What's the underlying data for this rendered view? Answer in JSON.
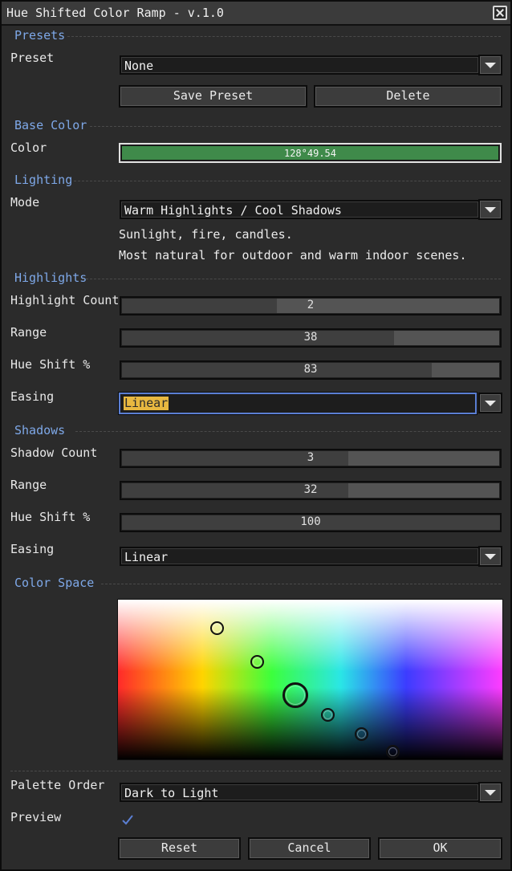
{
  "window": {
    "title": "Hue Shifted Color Ramp - v.1.0"
  },
  "sections": {
    "presets": "Presets",
    "base_color": "Base Color",
    "lighting": "Lighting",
    "highlights": "Highlights",
    "shadows": "Shadows",
    "color_space": "Color Space"
  },
  "presets": {
    "label": "Preset",
    "value": "None",
    "save_label": "Save Preset",
    "delete_label": "Delete"
  },
  "base_color": {
    "label": "Color",
    "value": "128°49.54",
    "swatch": "#3f8a4a"
  },
  "lighting": {
    "label": "Mode",
    "value": "Warm Highlights / Cool Shadows",
    "desc_line1": "Sunlight, fire, candles.",
    "desc_line2": "Most natural for outdoor and warm indoor scenes."
  },
  "highlights": {
    "count_label": "Highlight Count",
    "count_value": "2",
    "count_fill": 0.41,
    "range_label": "Range",
    "range_value": "38",
    "range_fill": 0.72,
    "hue_label": "Hue Shift %",
    "hue_value": "83",
    "hue_fill": 0.82,
    "easing_label": "Easing",
    "easing_value": "Linear"
  },
  "shadows": {
    "count_label": "Shadow Count",
    "count_value": "3",
    "count_fill": 0.6,
    "range_label": "Range",
    "range_value": "32",
    "range_fill": 0.6,
    "hue_label": "Hue Shift %",
    "hue_value": "100",
    "hue_fill": 1.0,
    "easing_label": "Easing",
    "easing_value": "Linear"
  },
  "palette": {
    "order_label": "Palette Order",
    "order_value": "Dark to Light",
    "preview_label": "Preview",
    "preview_checked": true
  },
  "footer": {
    "reset_label": "Reset",
    "cancel_label": "Cancel",
    "ok_label": "OK"
  },
  "colors": {
    "accent": "#7ea8e8",
    "focus": "#5b7fd3",
    "selection": "#e8b840"
  }
}
